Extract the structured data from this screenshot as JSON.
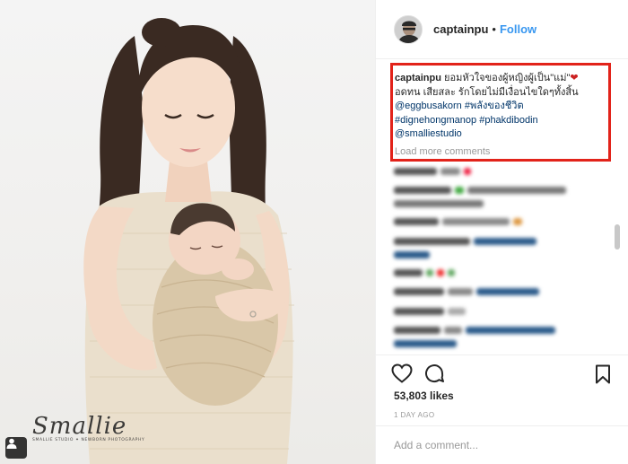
{
  "post": {
    "username": "captainpu",
    "separator": "•",
    "follow_label": "Follow"
  },
  "caption": {
    "username": "captainpu",
    "text_line1": "ยอมหัวใจของผู้หญิงผู้เป็น\"แม่\"",
    "text_line2": "อดทน เสียสละ รักโดยไม่มีเงื่อนไขใดๆทั้งสิ้น",
    "mention_1": "@eggbusakorn",
    "hashtag_1": "#พลังของชีวิต",
    "hashtag_2": "#dignehongmanop",
    "hashtag_3": "#phakdibodin",
    "mention_2": "@smalliestudio",
    "load_more": "Load more comments",
    "highlight_color": "#e2231a"
  },
  "stats": {
    "likes": "53,803 likes",
    "time": "1 DAY AGO"
  },
  "comment_input": {
    "placeholder": "Add a comment..."
  },
  "photo": {
    "watermark_script": "Smallie",
    "watermark_sub": "SMALLIE STUDIO ✦ NEWBORN PHOTOGRAPHY"
  },
  "icons": {
    "like": "heart-icon",
    "comment": "speech-bubble-icon",
    "save": "bookmark-icon",
    "tag": "person-tag-icon"
  },
  "colors": {
    "link": "#003569",
    "follow": "#3897f0",
    "muted": "#999999",
    "text": "#262626"
  }
}
